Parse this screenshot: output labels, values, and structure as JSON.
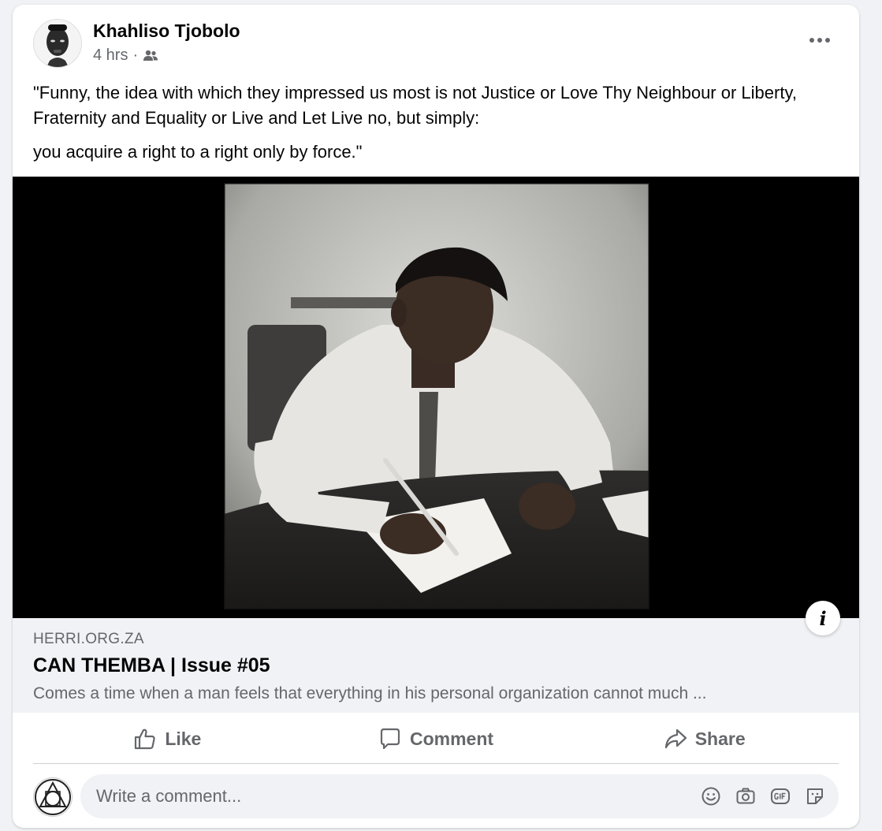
{
  "post": {
    "author": "Khahliso Tjobolo",
    "timestamp": "4 hrs",
    "separator": "·",
    "audience_icon": "friends-icon",
    "paragraphs": [
      "\"Funny, the idea with which they impressed us most is not Justice or Love Thy Neighbour or Liberty, Fraternity and Equality or Live and Let Live no, but simply:",
      "you acquire a right to a right only by force.\""
    ]
  },
  "media": {
    "info_label": "i"
  },
  "link_preview": {
    "domain": "HERRI.ORG.ZA",
    "title": "CAN THEMBA | Issue #05",
    "description": "Comes a time when a man feels that everything in his personal organization cannot much ..."
  },
  "actions": {
    "like": "Like",
    "comment": "Comment",
    "share": "Share"
  },
  "comment_box": {
    "placeholder": "Write a comment..."
  },
  "colors": {
    "card_bg": "#ffffff",
    "page_bg": "#f0f2f5",
    "secondary_text": "#65676b",
    "primary_text": "#050505"
  }
}
